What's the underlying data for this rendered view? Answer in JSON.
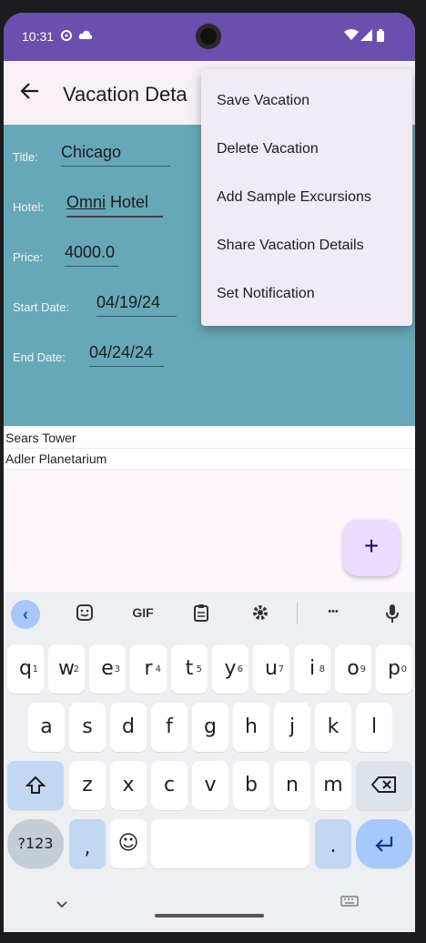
{
  "status_bar": {
    "time": "10:31",
    "left_icons": [
      "sync-icon",
      "cloud-icon"
    ],
    "right_icons": [
      "wifi-icon",
      "signal-icon",
      "battery-icon"
    ]
  },
  "app_bar": {
    "title": "Vacation Deta"
  },
  "form": {
    "title_label": "Title:",
    "title_value": "Chicago",
    "hotel_label": "Hotel:",
    "hotel_value_underlined": "Omni",
    "hotel_value_rest": " Hotel",
    "price_label": "Price:",
    "price_value": "4000.0",
    "start_label": "Start Date:",
    "start_value": "04/19/24",
    "end_label": "End Date:",
    "end_value": "04/24/24"
  },
  "excursions": [
    "Sears Tower",
    "Adler Planetarium"
  ],
  "fab_label": "+",
  "menu": [
    "Save Vacation",
    "Delete Vacation",
    "Add Sample Excursions",
    "Share Vacation Details",
    "Set Notification"
  ],
  "keyboard": {
    "toolbar": {
      "back": "‹",
      "gif": "GIF",
      "more": "•••"
    },
    "row1": [
      {
        "key": "q",
        "hint": "1"
      },
      {
        "key": "w",
        "hint": "2"
      },
      {
        "key": "e",
        "hint": "3"
      },
      {
        "key": "r",
        "hint": "4"
      },
      {
        "key": "t",
        "hint": "5"
      },
      {
        "key": "y",
        "hint": "6"
      },
      {
        "key": "u",
        "hint": "7"
      },
      {
        "key": "i",
        "hint": "8"
      },
      {
        "key": "o",
        "hint": "9"
      },
      {
        "key": "p",
        "hint": "0"
      }
    ],
    "row2": [
      "a",
      "s",
      "d",
      "f",
      "g",
      "h",
      "j",
      "k",
      "l"
    ],
    "row3": [
      "z",
      "x",
      "c",
      "v",
      "b",
      "n",
      "m"
    ],
    "symbols_key": "?123",
    "comma_key": ",",
    "period_key": ".",
    "emoji": "☺"
  },
  "accent_colors": {
    "status_bar": "#6b4fae",
    "form_background": "#67a8b8",
    "fab": "#e9ddff",
    "menu": "#f1ebf5"
  }
}
